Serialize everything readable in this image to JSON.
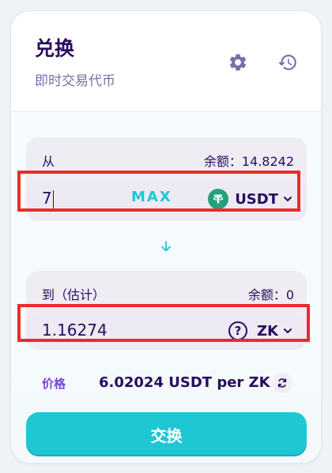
{
  "header": {
    "title": "兑换",
    "subtitle": "即时交易代币",
    "settings_icon": "gear-icon",
    "history_icon": "history-icon"
  },
  "from": {
    "label": "从",
    "balance": "余额：14.8242",
    "amount": "7",
    "max_label": "MAX",
    "token": "USDT",
    "token_icon": "tether-icon"
  },
  "to": {
    "label": "到（估计）",
    "balance": "余额：0",
    "amount": "1.16274",
    "token": "ZK",
    "token_icon": "question-icon"
  },
  "price": {
    "label": "价格",
    "value": "6.02024 USDT per ZK"
  },
  "swap_button": "交换",
  "colors": {
    "primary_text": "#280d5f",
    "accent": "#1fc7d4",
    "secondary": "#7645d9",
    "highlight": "#ee2a2a"
  }
}
